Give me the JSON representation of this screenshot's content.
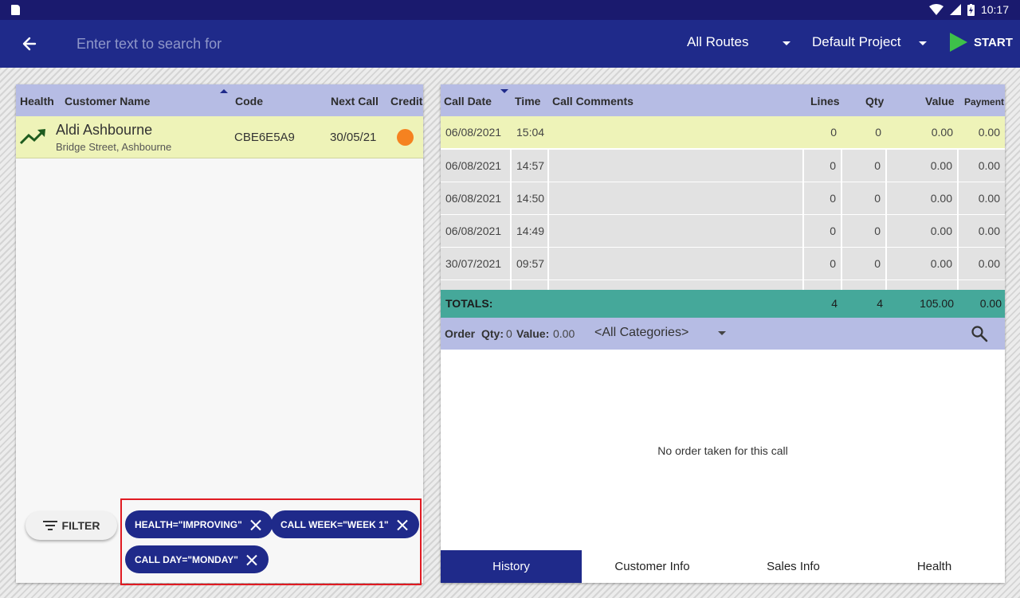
{
  "status_bar": {
    "time": "10:17"
  },
  "app_bar": {
    "search_placeholder": "Enter text to search for",
    "routes": "All Routes",
    "project": "Default Project",
    "start_label": "START"
  },
  "customers": {
    "columns": {
      "health": "Health",
      "name": "Customer Name",
      "code": "Code",
      "next_call": "Next Call",
      "credit": "Credit"
    },
    "rows": [
      {
        "name": "Aldi Ashbourne",
        "address": "Bridge Street, Ashbourne",
        "code": "CBE6E5A9",
        "next_call": "30/05/21",
        "health_icon": "trending-up-icon",
        "credit_color": "#f58220"
      }
    ]
  },
  "filter": {
    "button_label": "FILTER",
    "chips": [
      {
        "label": "HEALTH=\"IMPROVING\""
      },
      {
        "label": "CALL WEEK=\"WEEK 1\""
      },
      {
        "label": "CALL DAY=\"MONDAY\""
      }
    ]
  },
  "history": {
    "columns": {
      "date": "Call Date",
      "time": "Time",
      "comments": "Call Comments",
      "lines": "Lines",
      "qty": "Qty",
      "value": "Value",
      "payment": "Payment"
    },
    "rows": [
      {
        "date": "06/08/2021",
        "time": "15:04",
        "comments": "",
        "lines": "0",
        "qty": "0",
        "value": "0.00",
        "payment": "0.00"
      },
      {
        "date": "06/08/2021",
        "time": "14:57",
        "comments": "",
        "lines": "0",
        "qty": "0",
        "value": "0.00",
        "payment": "0.00"
      },
      {
        "date": "06/08/2021",
        "time": "14:50",
        "comments": "",
        "lines": "0",
        "qty": "0",
        "value": "0.00",
        "payment": "0.00"
      },
      {
        "date": "06/08/2021",
        "time": "14:49",
        "comments": "",
        "lines": "0",
        "qty": "0",
        "value": "0.00",
        "payment": "0.00"
      },
      {
        "date": "30/07/2021",
        "time": "09:57",
        "comments": "",
        "lines": "0",
        "qty": "0",
        "value": "0.00",
        "payment": "0.00"
      }
    ],
    "totals": {
      "label": "TOTALS:",
      "lines": "4",
      "qty": "4",
      "value": "105.00",
      "payment": "0.00"
    }
  },
  "order": {
    "label": "Order",
    "qty_label": "Qty:",
    "qty": "0",
    "value_label": "Value:",
    "value": "0.00",
    "category": "<All Categories>",
    "empty_message": "No order taken for this call"
  },
  "tabs": [
    {
      "label": "History",
      "active": true
    },
    {
      "label": "Customer Info",
      "active": false
    },
    {
      "label": "Sales Info",
      "active": false
    },
    {
      "label": "Health",
      "active": false
    }
  ],
  "colors": {
    "primary": "#1f2a8a",
    "header": "#b6bce4",
    "selected_row": "#eef3b8",
    "totals": "#45a89a",
    "start": "#3ec14a",
    "highlight_border": "#e01b22"
  }
}
